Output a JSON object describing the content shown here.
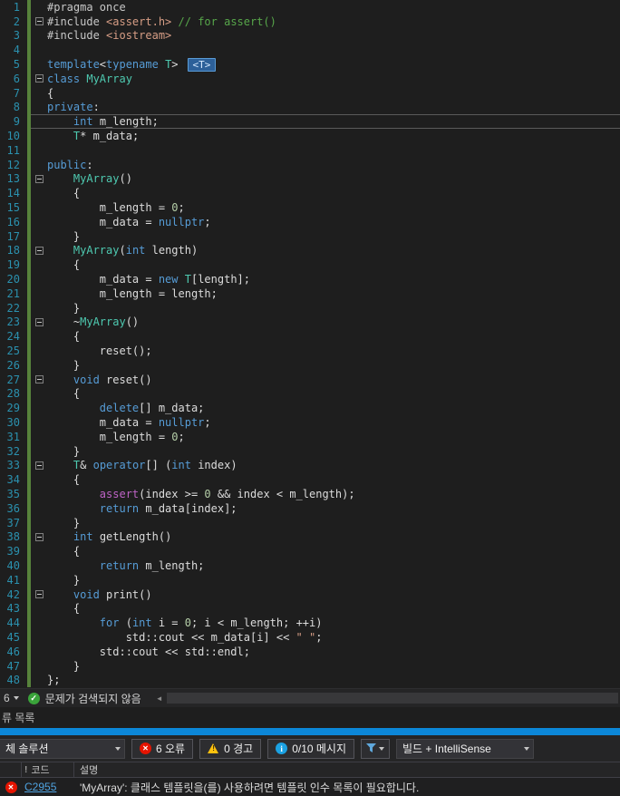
{
  "icons": {
    "check": "✓",
    "error_x": "✕",
    "warning_bang": "!",
    "info_i": "i",
    "scroll_left_arrow": "◄",
    "header_bang": "!"
  },
  "colors": {
    "editor_bg": "#1E1E1E",
    "panel_bg": "#252526",
    "accent_blue_strip": "#0C87D8",
    "error_red": "#E51400",
    "warning_yellow": "#FFC20E",
    "info_blue": "#1BA1E2",
    "success_green": "#3AA33A",
    "keyword": "#569CD6",
    "type": "#4EC9B0",
    "string": "#D69D85",
    "comment": "#57A64A",
    "number": "#B5CEA8",
    "macro": "#BD63C5",
    "directive": "#C8C8C8",
    "plain_text": "#DCDCDC",
    "line_number": "#2B91AF",
    "change_bar": "#57823B"
  },
  "editor": {
    "template_hint_badge": "<T>",
    "lines": [
      {
        "n": 1,
        "tokens": [
          [
            "d",
            "#pragma once"
          ]
        ]
      },
      {
        "n": 2,
        "fold": true,
        "tokens": [
          [
            "d",
            "#include "
          ],
          [
            "s",
            "<assert.h>"
          ],
          [
            "pl",
            " "
          ],
          [
            "c",
            "// for assert()"
          ]
        ]
      },
      {
        "n": 3,
        "tokens": [
          [
            "d",
            "#include "
          ],
          [
            "s",
            "<iostream>"
          ]
        ]
      },
      {
        "n": 4,
        "tokens": [
          [
            "pl",
            ""
          ]
        ]
      },
      {
        "n": 5,
        "badge": "<T>",
        "tokens": [
          [
            "k",
            "template"
          ],
          [
            "pl",
            "<"
          ],
          [
            "k",
            "typename"
          ],
          [
            "pl",
            " "
          ],
          [
            "t",
            "T"
          ],
          [
            "pl",
            ">"
          ]
        ]
      },
      {
        "n": 6,
        "fold": true,
        "tokens": [
          [
            "k",
            "class"
          ],
          [
            "pl",
            " "
          ],
          [
            "t",
            "MyArray"
          ]
        ]
      },
      {
        "n": 7,
        "tokens": [
          [
            "pl",
            "{"
          ]
        ]
      },
      {
        "n": 8,
        "tokens": [
          [
            "k",
            "private"
          ],
          [
            "pl",
            ":"
          ]
        ]
      },
      {
        "n": 9,
        "current": true,
        "tokens": [
          [
            "pl",
            "    "
          ],
          [
            "k",
            "int"
          ],
          [
            "pl",
            " m_length;"
          ]
        ]
      },
      {
        "n": 10,
        "tokens": [
          [
            "pl",
            "    "
          ],
          [
            "t",
            "T"
          ],
          [
            "pl",
            "* m_data;"
          ]
        ]
      },
      {
        "n": 11,
        "tokens": [
          [
            "pl",
            ""
          ]
        ]
      },
      {
        "n": 12,
        "tokens": [
          [
            "k",
            "public"
          ],
          [
            "pl",
            ":"
          ]
        ]
      },
      {
        "n": 13,
        "fold": true,
        "tokens": [
          [
            "pl",
            "    "
          ],
          [
            "t",
            "MyArray"
          ],
          [
            "pl",
            "()"
          ]
        ]
      },
      {
        "n": 14,
        "tokens": [
          [
            "pl",
            "    {"
          ]
        ]
      },
      {
        "n": 15,
        "tokens": [
          [
            "pl",
            "        m_length = "
          ],
          [
            "n2",
            "0"
          ],
          [
            "pl",
            ";"
          ]
        ]
      },
      {
        "n": 16,
        "tokens": [
          [
            "pl",
            "        m_data = "
          ],
          [
            "k",
            "nullptr"
          ],
          [
            "pl",
            ";"
          ]
        ]
      },
      {
        "n": 17,
        "tokens": [
          [
            "pl",
            "    }"
          ]
        ]
      },
      {
        "n": 18,
        "fold": true,
        "tokens": [
          [
            "pl",
            "    "
          ],
          [
            "t",
            "MyArray"
          ],
          [
            "pl",
            "("
          ],
          [
            "k",
            "int"
          ],
          [
            "pl",
            " length)"
          ]
        ]
      },
      {
        "n": 19,
        "tokens": [
          [
            "pl",
            "    {"
          ]
        ]
      },
      {
        "n": 20,
        "tokens": [
          [
            "pl",
            "        m_data = "
          ],
          [
            "k",
            "new"
          ],
          [
            "pl",
            " "
          ],
          [
            "t",
            "T"
          ],
          [
            "pl",
            "[length];"
          ]
        ]
      },
      {
        "n": 21,
        "tokens": [
          [
            "pl",
            "        m_length = length;"
          ]
        ]
      },
      {
        "n": 22,
        "tokens": [
          [
            "pl",
            "    }"
          ]
        ]
      },
      {
        "n": 23,
        "fold": true,
        "tokens": [
          [
            "pl",
            "    ~"
          ],
          [
            "t",
            "MyArray"
          ],
          [
            "pl",
            "()"
          ]
        ]
      },
      {
        "n": 24,
        "tokens": [
          [
            "pl",
            "    {"
          ]
        ]
      },
      {
        "n": 25,
        "tokens": [
          [
            "pl",
            "        reset();"
          ]
        ]
      },
      {
        "n": 26,
        "tokens": [
          [
            "pl",
            "    }"
          ]
        ]
      },
      {
        "n": 27,
        "fold": true,
        "tokens": [
          [
            "pl",
            "    "
          ],
          [
            "k",
            "void"
          ],
          [
            "pl",
            " reset()"
          ]
        ]
      },
      {
        "n": 28,
        "tokens": [
          [
            "pl",
            "    {"
          ]
        ]
      },
      {
        "n": 29,
        "tokens": [
          [
            "pl",
            "        "
          ],
          [
            "k",
            "delete"
          ],
          [
            "pl",
            "[] m_data;"
          ]
        ]
      },
      {
        "n": 30,
        "tokens": [
          [
            "pl",
            "        m_data = "
          ],
          [
            "k",
            "nullptr"
          ],
          [
            "pl",
            ";"
          ]
        ]
      },
      {
        "n": 31,
        "tokens": [
          [
            "pl",
            "        m_length = "
          ],
          [
            "n2",
            "0"
          ],
          [
            "pl",
            ";"
          ]
        ]
      },
      {
        "n": 32,
        "tokens": [
          [
            "pl",
            "    }"
          ]
        ]
      },
      {
        "n": 33,
        "fold": true,
        "tokens": [
          [
            "pl",
            "    "
          ],
          [
            "t",
            "T"
          ],
          [
            "pl",
            "& "
          ],
          [
            "k",
            "operator"
          ],
          [
            "pl",
            "[] ("
          ],
          [
            "k",
            "int"
          ],
          [
            "pl",
            " index)"
          ]
        ]
      },
      {
        "n": 34,
        "tokens": [
          [
            "pl",
            "    {"
          ]
        ]
      },
      {
        "n": 35,
        "tokens": [
          [
            "pl",
            "        "
          ],
          [
            "m",
            "assert"
          ],
          [
            "pl",
            "(index >= "
          ],
          [
            "n2",
            "0"
          ],
          [
            "pl",
            " && index < m_length);"
          ]
        ]
      },
      {
        "n": 36,
        "tokens": [
          [
            "pl",
            "        "
          ],
          [
            "k",
            "return"
          ],
          [
            "pl",
            " m_data[index];"
          ]
        ]
      },
      {
        "n": 37,
        "tokens": [
          [
            "pl",
            "    }"
          ]
        ]
      },
      {
        "n": 38,
        "fold": true,
        "tokens": [
          [
            "pl",
            "    "
          ],
          [
            "k",
            "int"
          ],
          [
            "pl",
            " getLength()"
          ]
        ]
      },
      {
        "n": 39,
        "tokens": [
          [
            "pl",
            "    {"
          ]
        ]
      },
      {
        "n": 40,
        "tokens": [
          [
            "pl",
            "        "
          ],
          [
            "k",
            "return"
          ],
          [
            "pl",
            " m_length;"
          ]
        ]
      },
      {
        "n": 41,
        "tokens": [
          [
            "pl",
            "    }"
          ]
        ]
      },
      {
        "n": 42,
        "fold": true,
        "tokens": [
          [
            "pl",
            "    "
          ],
          [
            "k",
            "void"
          ],
          [
            "pl",
            " print()"
          ]
        ]
      },
      {
        "n": 43,
        "tokens": [
          [
            "pl",
            "    {"
          ]
        ]
      },
      {
        "n": 44,
        "tokens": [
          [
            "pl",
            "        "
          ],
          [
            "k",
            "for"
          ],
          [
            "pl",
            " ("
          ],
          [
            "k",
            "int"
          ],
          [
            "pl",
            " i = "
          ],
          [
            "n2",
            "0"
          ],
          [
            "pl",
            "; i < m_length; ++i)"
          ]
        ]
      },
      {
        "n": 45,
        "tokens": [
          [
            "pl",
            "            std::cout << m_data[i] << "
          ],
          [
            "s",
            "\" \""
          ],
          [
            "pl",
            ";"
          ]
        ]
      },
      {
        "n": 46,
        "tokens": [
          [
            "pl",
            "        std::cout << std::endl;"
          ]
        ]
      },
      {
        "n": 47,
        "tokens": [
          [
            "pl",
            "    }"
          ]
        ]
      },
      {
        "n": 48,
        "tokens": [
          [
            "pl",
            "};"
          ]
        ]
      }
    ]
  },
  "health_bar": {
    "zoom_fragment": "6",
    "status_text": "문제가 검색되지 않음"
  },
  "error_list": {
    "title": "류 목록",
    "toolbar": {
      "scope_dropdown": "체 솔루션",
      "errors_button": "6 오류",
      "warnings_button": "0 경고",
      "messages_button": "0/10 메시지",
      "filter_dropdown": "빌드 + IntelliSense"
    },
    "columns": {
      "code": "코드",
      "description": "설명"
    },
    "rows": [
      {
        "code": "C2955",
        "description": "'MyArray': 클래스 템플릿을(를) 사용하려면 템플릿 인수 목록이 필요합니다."
      }
    ]
  }
}
